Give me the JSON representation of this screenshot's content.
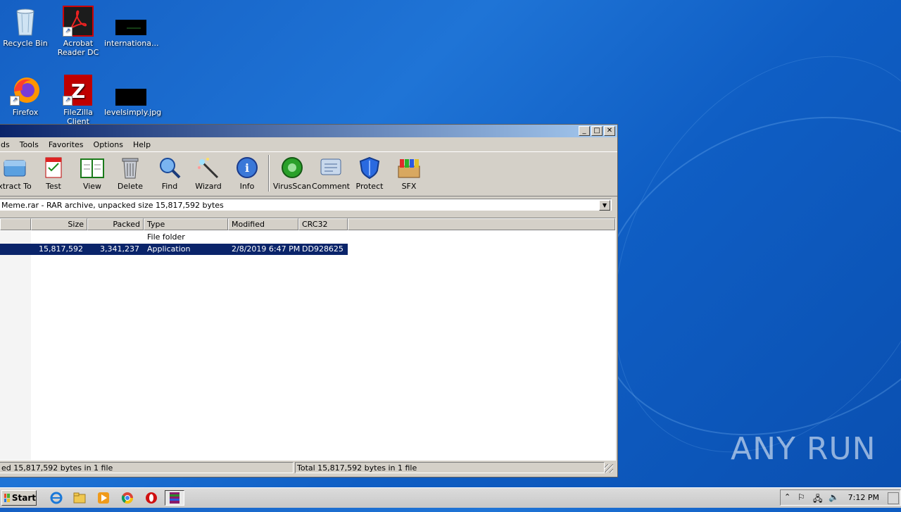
{
  "desktop": {
    "icons": [
      {
        "label": "Recycle Bin"
      },
      {
        "label": "Acrobat Reader DC"
      },
      {
        "label": "internationa..."
      },
      {
        "label": "Firefox"
      },
      {
        "label": "FileZilla Client"
      },
      {
        "label": "levelsimply.jpg"
      }
    ],
    "watermark": "ANY  RUN"
  },
  "winrar": {
    "menu": [
      "ds",
      "Tools",
      "Favorites",
      "Options",
      "Help"
    ],
    "toolbar": [
      {
        "label": "xtract To",
        "icon": "extract-to-icon"
      },
      {
        "label": "Test",
        "icon": "test-icon"
      },
      {
        "label": "View",
        "icon": "view-icon"
      },
      {
        "label": "Delete",
        "icon": "delete-icon"
      },
      {
        "label": "Find",
        "icon": "find-icon"
      },
      {
        "label": "Wizard",
        "icon": "wizard-icon"
      },
      {
        "label": "Info",
        "icon": "info-icon"
      },
      {
        "label": "VirusScan",
        "icon": "virusscan-icon"
      },
      {
        "label": "Comment",
        "icon": "comment-icon"
      },
      {
        "label": "Protect",
        "icon": "protect-icon"
      },
      {
        "label": "SFX",
        "icon": "sfx-icon"
      }
    ],
    "path": "Meme.rar - RAR archive, unpacked size 15,817,592 bytes",
    "columns": [
      "Size",
      "Packed",
      "Type",
      "Modified",
      "CRC32"
    ],
    "rows": [
      {
        "size": "",
        "packed": "",
        "type": "File folder",
        "modified": "",
        "crc": "",
        "selected": false
      },
      {
        "size": "15,817,592",
        "packed": "3,341,237",
        "type": "Application",
        "modified": "2/8/2019 6:47 PM",
        "crc": "DD928625",
        "selected": true
      }
    ],
    "status_left": "ed 15,817,592 bytes in 1 file",
    "status_right": "Total 15,817,592 bytes in 1 file"
  },
  "taskbar": {
    "start_label": "Start",
    "clock": "7:12 PM"
  }
}
